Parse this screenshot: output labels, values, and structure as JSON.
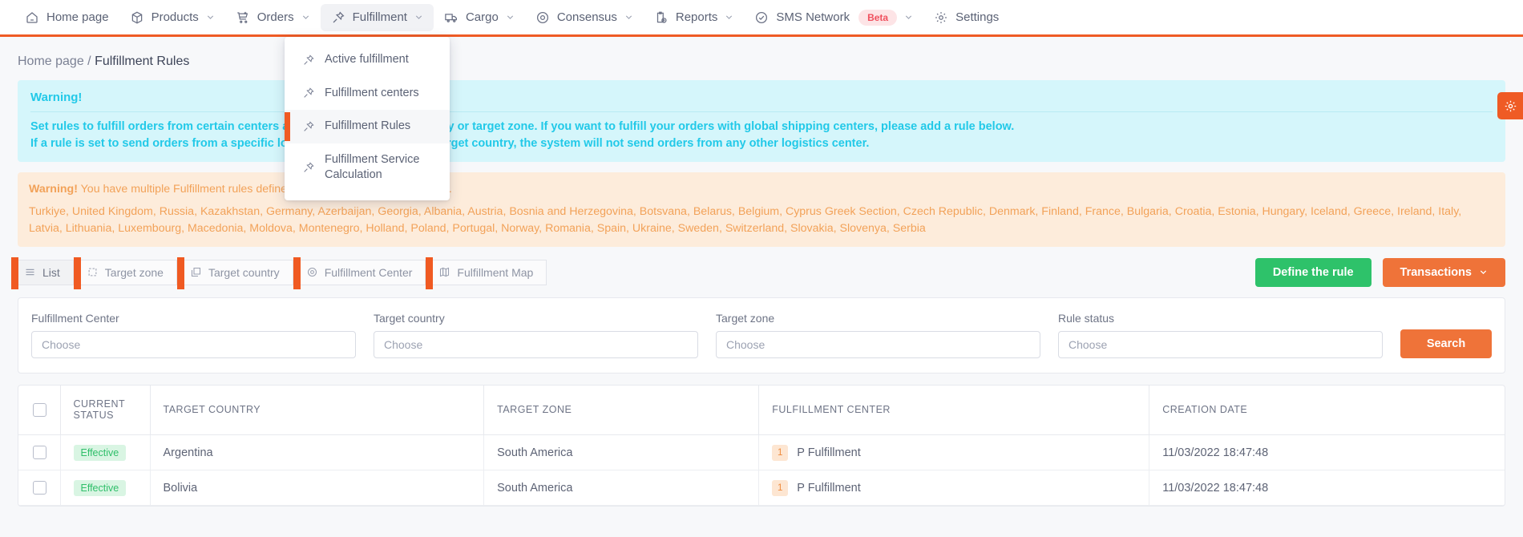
{
  "nav": {
    "items": [
      {
        "label": "Home page",
        "icon": "home-icon",
        "caret": false,
        "active": false
      },
      {
        "label": "Products",
        "icon": "box-icon",
        "caret": true,
        "active": false
      },
      {
        "label": "Orders",
        "icon": "cart-plus-icon",
        "caret": true,
        "active": false
      },
      {
        "label": "Fulfillment",
        "icon": "pin-icon",
        "caret": true,
        "active": true
      },
      {
        "label": "Cargo",
        "icon": "truck-icon",
        "caret": true,
        "active": false
      },
      {
        "label": "Consensus",
        "icon": "target-icon",
        "caret": true,
        "active": false
      },
      {
        "label": "Reports",
        "icon": "clipboard-clock-icon",
        "caret": true,
        "active": false
      },
      {
        "label": "SMS Network",
        "icon": "check-circle-icon",
        "caret": true,
        "active": false,
        "badge": "Beta"
      },
      {
        "label": "Settings",
        "icon": "gear-icon",
        "caret": false,
        "active": false
      }
    ]
  },
  "dropdown": {
    "items": [
      {
        "label": "Active fulfillment",
        "active": false
      },
      {
        "label": "Fulfillment centers",
        "active": false
      },
      {
        "label": "Fulfillment Rules",
        "active": true
      },
      {
        "label": "Fulfillment Service Calculation",
        "active": false
      }
    ]
  },
  "breadcrumb": {
    "root": "Home page",
    "separator": "/",
    "current": "Fulfillment Rules"
  },
  "info_banner": {
    "title": "Warning!",
    "line1": "Set rules to fulfill orders from certain centers according to the target country or target zone. If you want to fulfill your orders with global shipping centers, please add a rule below.",
    "line2": "If a rule is set to send orders from a specific logistics center to a specific target country, the system will not send orders from any other logistics center."
  },
  "warning_banner": {
    "title": "Warning!",
    "message": "You have multiple Fulfillment rules defined for the same target country (s).",
    "countries": "Turkiye, United Kingdom, Russia, Kazakhstan, Germany, Azerbaijan, Georgia, Albania, Austria, Bosnia and Herzegovina, Botsvana, Belarus, Belgium, Cyprus Greek Section, Czech Republic, Denmark, Finland, France, Bulgaria, Croatia, Estonia, Hungary, Iceland, Greece, Ireland, Italy, Latvia, Lithuania, Luxembourg, Macedonia, Moldova, Montenegro, Holland, Poland, Portugal, Norway, Romania, Spain, Ukraine, Sweden, Switzerland, Slovakia, Slovenya, Serbia"
  },
  "tabs": [
    {
      "label": "List",
      "icon": "list-icon",
      "active": true
    },
    {
      "label": "Target zone",
      "icon": "zone-icon",
      "active": false
    },
    {
      "label": "Target country",
      "icon": "copy-icon",
      "active": false
    },
    {
      "label": "Fulfillment Center",
      "icon": "location-pin-icon",
      "active": false
    },
    {
      "label": "Fulfillment Map",
      "icon": "map-icon",
      "active": false
    }
  ],
  "actions": {
    "define_rule": "Define the rule",
    "transactions": "Transactions"
  },
  "filters": {
    "fields": [
      {
        "label": "Fulfillment Center",
        "value": "Choose"
      },
      {
        "label": "Target country",
        "value": "Choose"
      },
      {
        "label": "Target zone",
        "value": "Choose"
      },
      {
        "label": "Rule status",
        "value": "Choose"
      }
    ],
    "search_label": "Search"
  },
  "table": {
    "columns": [
      "CURRENT STATUS",
      "TARGET COUNTRY",
      "TARGET ZONE",
      "FULFILLMENT CENTER",
      "CREATION DATE"
    ],
    "rows": [
      {
        "status": "Effective",
        "country": "Argentina",
        "zone": "South America",
        "center_num": "1",
        "center": "P Fulfillment",
        "date": "11/03/2022 18:47:48"
      },
      {
        "status": "Effective",
        "country": "Bolivia",
        "zone": "South America",
        "center_num": "1",
        "center": "P Fulfillment",
        "date": "11/03/2022 18:47:48"
      }
    ]
  },
  "fab": {
    "icon": "gear-icon"
  },
  "colors": {
    "accent_orange": "#ef5b25",
    "green": "#2ec26a",
    "orange_btn": "#ef7339",
    "cyan": "#22c9e8",
    "warn_orange": "#f2a259",
    "beta_pink": "#f0505e"
  }
}
